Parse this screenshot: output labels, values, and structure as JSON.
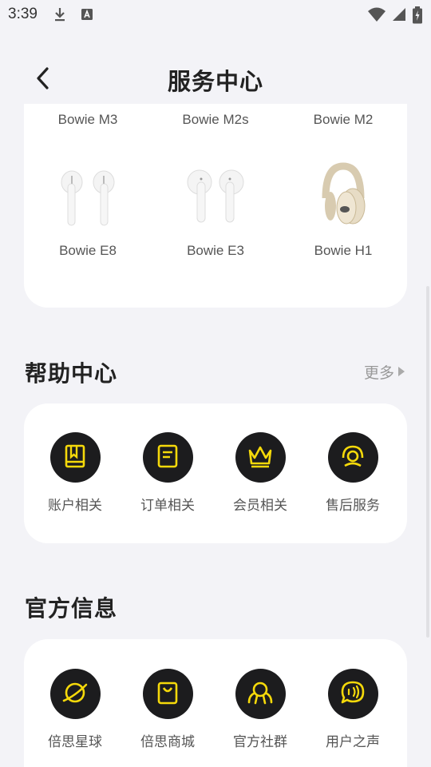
{
  "status_bar": {
    "time": "3:39",
    "left_icons": [
      "download-icon",
      "font-a-icon"
    ],
    "right_icons": [
      "wifi-icon",
      "signal-icon",
      "battery-icon"
    ]
  },
  "header": {
    "title": "服务中心",
    "back_icon": "chevron-left-icon"
  },
  "products": {
    "row1": [
      "Bowie M3",
      "Bowie M2s",
      "Bowie M2"
    ],
    "row2": [
      "Bowie E8",
      "Bowie E3",
      "Bowie H1"
    ]
  },
  "help_center": {
    "title": "帮助中心",
    "more_label": "更多",
    "items": [
      {
        "label": "账户相关",
        "icon": "book-icon"
      },
      {
        "label": "订单相关",
        "icon": "document-icon"
      },
      {
        "label": "会员相关",
        "icon": "crown-icon"
      },
      {
        "label": "售后服务",
        "icon": "headset-icon"
      }
    ]
  },
  "official_info": {
    "title": "官方信息",
    "items": [
      {
        "label": "倍思星球",
        "icon": "planet-icon"
      },
      {
        "label": "倍思商城",
        "icon": "shopping-bag-icon"
      },
      {
        "label": "官方社群",
        "icon": "community-icon"
      },
      {
        "label": "用户之声",
        "icon": "chat-bubble-icon"
      }
    ]
  },
  "colors": {
    "accent": "#f5d90a",
    "icon_bg": "#1c1c1e",
    "background": "#f3f3f7",
    "card": "#ffffff"
  }
}
